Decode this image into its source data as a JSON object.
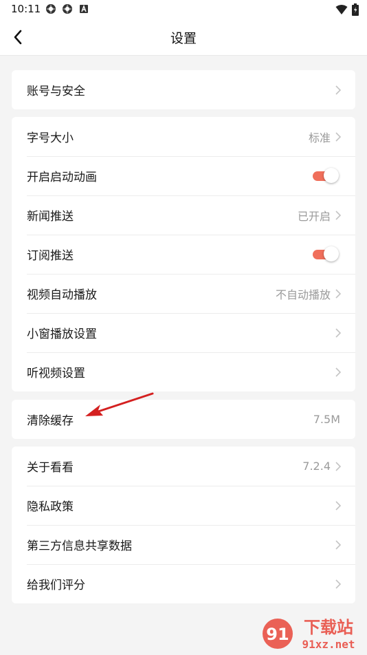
{
  "status_bar": {
    "time": "10:11",
    "icons": [
      "app-icon",
      "app-icon",
      "notification-a-icon"
    ],
    "right_icons": [
      "wifi-icon",
      "battery-icon"
    ]
  },
  "header": {
    "title": "设置",
    "back_icon": "back-arrow-icon"
  },
  "groups": [
    {
      "items": [
        {
          "label": "账号与安全",
          "value": "",
          "control": "chevron"
        }
      ]
    },
    {
      "items": [
        {
          "label": "字号大小",
          "value": "标准",
          "control": "chevron"
        },
        {
          "label": "开启启动动画",
          "value": "",
          "control": "toggle",
          "on": true
        },
        {
          "label": "新闻推送",
          "value": "已开启",
          "control": "chevron"
        },
        {
          "label": "订阅推送",
          "value": "",
          "control": "toggle",
          "on": true
        },
        {
          "label": "视频自动播放",
          "value": "不自动播放",
          "control": "chevron"
        },
        {
          "label": "小窗播放设置",
          "value": "",
          "control": "chevron"
        },
        {
          "label": "听视频设置",
          "value": "",
          "control": "chevron"
        }
      ]
    },
    {
      "items": [
        {
          "label": "清除缓存",
          "value": "7.5M",
          "control": "none"
        }
      ]
    },
    {
      "items": [
        {
          "label": "关于看看",
          "value": "7.2.4",
          "control": "chevron"
        },
        {
          "label": "隐私政策",
          "value": "",
          "control": "chevron"
        },
        {
          "label": "第三方信息共享数据",
          "value": "",
          "control": "chevron"
        },
        {
          "label": "给我们评分",
          "value": "",
          "control": "chevron"
        }
      ]
    }
  ],
  "colors": {
    "accent": "#f06f5b",
    "annotation_arrow": "#d42020",
    "background": "#f4f4f4"
  },
  "watermark": {
    "text": "下载站",
    "domain": "91xz.net"
  }
}
